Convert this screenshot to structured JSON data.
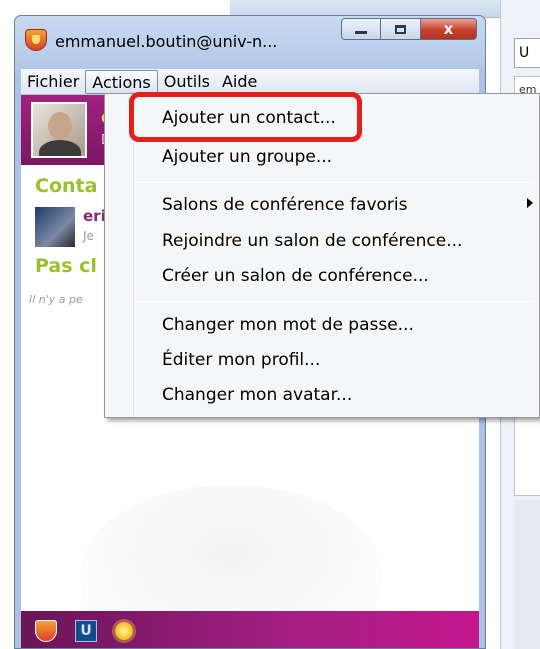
{
  "window": {
    "title": "emmanuel.boutin@univ-n...",
    "close_glyph": "x"
  },
  "menubar": {
    "items": [
      "Fichier",
      "Actions",
      "Outils",
      "Aide"
    ],
    "active": "Actions"
  },
  "profile": {
    "name_initial": "e",
    "status_initial": "D"
  },
  "contacts_section": {
    "title": "Conta",
    "contact_name": "eri",
    "contact_sub": "Je"
  },
  "unclassified_section": {
    "title": "Pas cl",
    "empty_text": "Il n'y a pe"
  },
  "actions_menu": {
    "items": [
      "Ajouter un contact...",
      "Ajouter un groupe...",
      "Salons de conférence favoris",
      "Rejoindre un salon de conférence...",
      "Créer un salon de conférence...",
      "Changer mon mot de passe...",
      "Éditer mon profil...",
      "Changer mon avatar..."
    ],
    "highlighted": "Ajouter un contact..."
  },
  "background_window": {
    "field_text": "U",
    "pane_text": "em"
  },
  "bottom_bar": {
    "u_icon_glyph": "U"
  },
  "colors": {
    "accent_purple": "#a2217f",
    "section_green": "#9bc02a",
    "highlight_red": "#e5201b"
  },
  "icons": [
    "app-logo-icon",
    "minimize-icon",
    "maximize-icon",
    "close-icon",
    "submenu-arrow-icon",
    "univ-u-icon",
    "sun-icon"
  ]
}
